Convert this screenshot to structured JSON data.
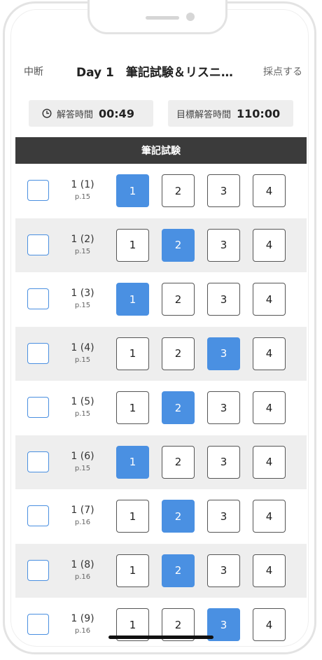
{
  "nav": {
    "left": "中断",
    "title": "Day 1　筆記試験＆リスニ…",
    "right": "採点する"
  },
  "timers": {
    "elapsed_label": "解答時間",
    "elapsed_value": "00:49",
    "target_label": "目標解答時間",
    "target_value": "110:00"
  },
  "section": {
    "title": "筆記試験"
  },
  "questions": [
    {
      "num": "1 (1)",
      "page": "p.15",
      "options": [
        "1",
        "2",
        "3",
        "4"
      ],
      "selected": 1
    },
    {
      "num": "1 (2)",
      "page": "p.15",
      "options": [
        "1",
        "2",
        "3",
        "4"
      ],
      "selected": 2
    },
    {
      "num": "1 (3)",
      "page": "p.15",
      "options": [
        "1",
        "2",
        "3",
        "4"
      ],
      "selected": 1
    },
    {
      "num": "1 (4)",
      "page": "p.15",
      "options": [
        "1",
        "2",
        "3",
        "4"
      ],
      "selected": 3
    },
    {
      "num": "1 (5)",
      "page": "p.15",
      "options": [
        "1",
        "2",
        "3",
        "4"
      ],
      "selected": 2
    },
    {
      "num": "1 (6)",
      "page": "p.15",
      "options": [
        "1",
        "2",
        "3",
        "4"
      ],
      "selected": 1
    },
    {
      "num": "1 (7)",
      "page": "p.16",
      "options": [
        "1",
        "2",
        "3",
        "4"
      ],
      "selected": 2
    },
    {
      "num": "1 (8)",
      "page": "p.16",
      "options": [
        "1",
        "2",
        "3",
        "4"
      ],
      "selected": 2
    },
    {
      "num": "1 (9)",
      "page": "p.16",
      "options": [
        "1",
        "2",
        "3",
        "4"
      ],
      "selected": 3
    }
  ],
  "colors": {
    "accent": "#4a90e2",
    "header_bg": "#3b3b3b",
    "alt_row_bg": "#eeeeee"
  },
  "icons": {
    "timer": "clock-icon"
  }
}
